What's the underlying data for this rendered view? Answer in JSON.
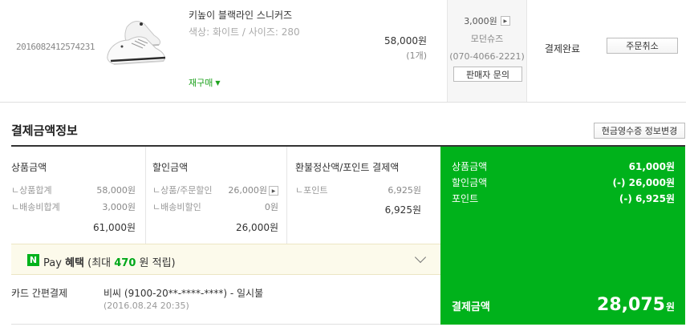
{
  "order": {
    "order_number": "2016082412574231",
    "product_name": "키높이 블랙라인 스니커즈",
    "option": "색상: 화이트 / 사이즈: 280",
    "rebuy_label": "재구매",
    "price": "58,000원",
    "quantity": "(1개)",
    "shipping_fee": "3,000원",
    "seller_name": "모던슈즈",
    "seller_phone": "(070-4066-2221)",
    "seller_inquiry_label": "판매자 문의",
    "status": "결제완료",
    "cancel_label": "주문취소"
  },
  "payment_info": {
    "title": "결제금액정보",
    "receipt_button_label": "현금영수증 정보변경",
    "product_col": {
      "title": "상품금액",
      "items": [
        {
          "label": "상품합계",
          "value": "58,000원"
        },
        {
          "label": "배송비합계",
          "value": "3,000원"
        }
      ],
      "total": "61,000원"
    },
    "discount_col": {
      "title": "할인금액",
      "items": [
        {
          "label": "상품/주문할인",
          "value": "26,000원"
        },
        {
          "label": "배송비할인",
          "value": "0원"
        }
      ],
      "total": "26,000원"
    },
    "refund_col": {
      "title": "환불정산액/포인트 결제액",
      "items": [
        {
          "label": "포인트",
          "value": "6,925원"
        }
      ],
      "total": "6,925원"
    },
    "summary": {
      "rows": [
        {
          "label": "상품금액",
          "value": "61,000원"
        },
        {
          "label": "할인금액",
          "value": "(-) 26,000원"
        },
        {
          "label": "포인트",
          "value": "(-) 6,925원"
        }
      ],
      "total_label": "결제금액",
      "total_value": "28,075",
      "total_unit": "원"
    },
    "npay": {
      "logo": "N",
      "pay": "Pay",
      "benefit": "혜택",
      "detail_prefix": "(최대",
      "points": "470",
      "detail_suffix": "원 적립)"
    },
    "method": {
      "label": "카드 간편결제",
      "detail": "비씨 (9100-20**-****-****) - 일시불",
      "date": "(2016.08.24 20:35)"
    }
  },
  "colors": {
    "accent_green": "#00b21b",
    "benefit_bg": "#fcfaeb"
  }
}
